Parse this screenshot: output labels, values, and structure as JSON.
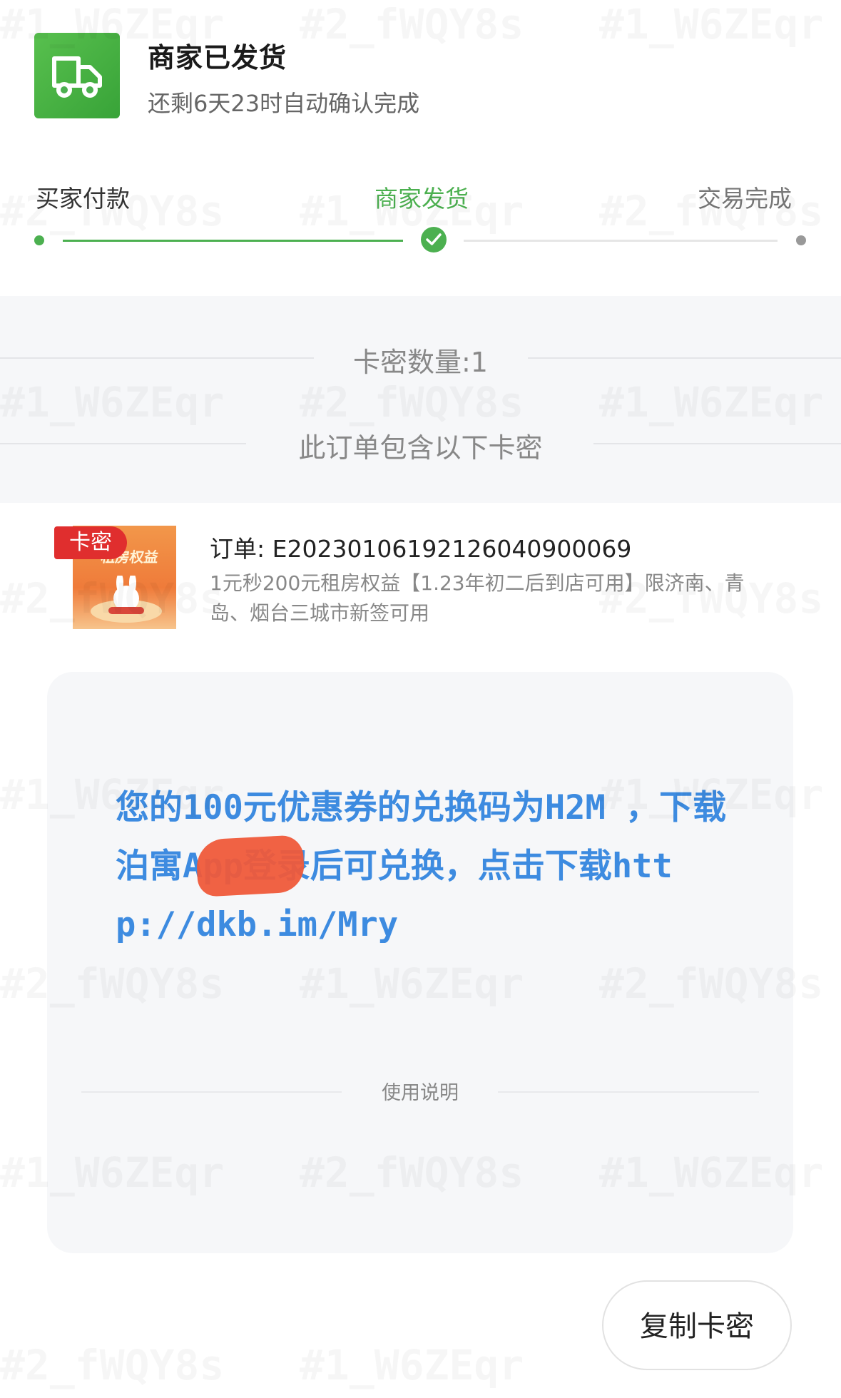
{
  "header": {
    "status_title": "商家已发货",
    "status_sub": "还剩6天23时自动确认完成",
    "icon": "truck-icon",
    "accent_color": "#4cb050"
  },
  "steps": [
    {
      "label": "买家付款",
      "state": "done"
    },
    {
      "label": "商家发货",
      "state": "current"
    },
    {
      "label": "交易完成",
      "state": "pending"
    }
  ],
  "summary": {
    "card_count": "卡密数量:1",
    "contains_note": "此订单包含以下卡密"
  },
  "order": {
    "tag": "卡密",
    "order_no": "订单: E20230106192126040900069",
    "description": "1元秒200元租房权益【1.23年初二后到店可用】限济南、青岛、烟台三城市新签可用",
    "thumb_caption": "租房权益"
  },
  "card": {
    "code_text": "您的100元优惠券的兑换码为H2M ，下载泊寓App登录后可兑换，点击下载http://dkb.im/Mry",
    "text_color": "#3d8be0",
    "usage_label": "使用说明"
  },
  "actions": {
    "copy_label": "复制卡密"
  },
  "watermark": [
    "#1_W6ZEqr",
    "#2_fWQY8s"
  ]
}
